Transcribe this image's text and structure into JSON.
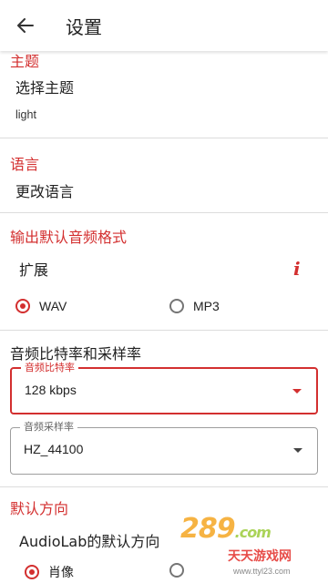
{
  "appbar": {
    "title": "设置",
    "back_icon": "arrow-left-icon"
  },
  "theme": {
    "section_title": "主题",
    "label": "选择主题",
    "value": "light"
  },
  "language": {
    "section_title": "语言",
    "label": "更改语言"
  },
  "output_format": {
    "section_title": "输出默认音频格式",
    "extension_label": "扩展",
    "info_icon": "info-icon",
    "options": [
      {
        "label": "WAV",
        "checked": true
      },
      {
        "label": "MP3",
        "checked": false
      }
    ]
  },
  "bitrate": {
    "section_label": "音频比特率和采样率",
    "bitrate_legend": "音频比特率",
    "bitrate_value": "128 kbps",
    "samplerate_legend": "音频采样率",
    "samplerate_value": "HZ_44100"
  },
  "orientation": {
    "section_title": "默认方向",
    "label": "AudioLab的默认方向",
    "options": [
      {
        "label": "肖像",
        "checked": true
      }
    ]
  },
  "watermark": {
    "brand": "289",
    "brand_suffix": ".com",
    "site": "天天游戏网",
    "url": "www.ttyl23.com"
  },
  "colors": {
    "accent": "#d32f2f",
    "watermark_orange": "#f5a623"
  }
}
